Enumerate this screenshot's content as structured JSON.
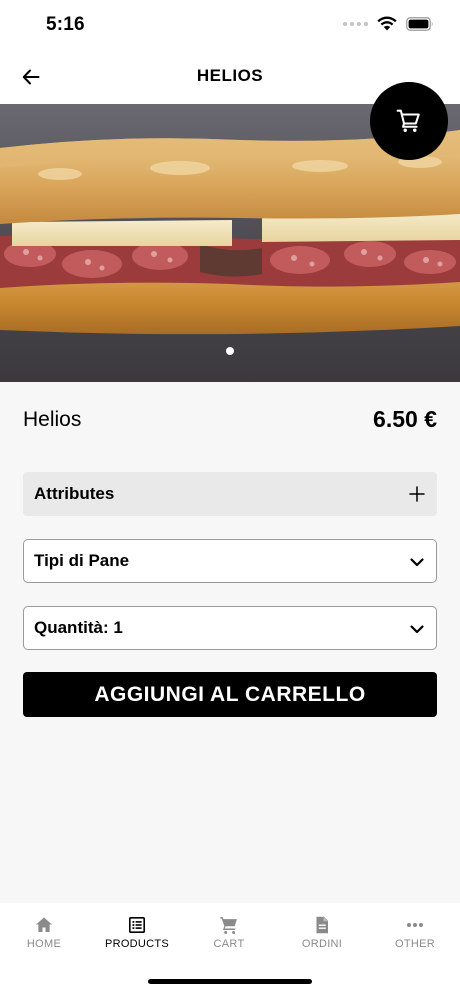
{
  "status_bar": {
    "time": "5:16"
  },
  "header": {
    "title": "HELIOS",
    "back_icon": "arrow-left-icon"
  },
  "cart_fab": {
    "icon": "cart-icon"
  },
  "carousel": {
    "image_subject": "salami and cheese baguette sandwich",
    "page_count": 1,
    "active_index": 0
  },
  "product": {
    "name": "Helios",
    "price": "6.50 €"
  },
  "attributes": {
    "label": "Attributes",
    "icon": "plus-icon"
  },
  "bread_select": {
    "label": "Tipi di Pane",
    "icon": "chevron-down-icon"
  },
  "quantity_select": {
    "label": "Quantità: 1",
    "icon": "chevron-down-icon"
  },
  "add_to_cart": {
    "label": "AGGIUNGI AL CARRELLO"
  },
  "bottom_nav": {
    "items": [
      {
        "label": "HOME",
        "icon": "home-icon",
        "active": false
      },
      {
        "label": "PRODUCTS",
        "icon": "list-icon",
        "active": true
      },
      {
        "label": "CART",
        "icon": "cart-icon",
        "active": false
      },
      {
        "label": "ORDINI",
        "icon": "document-icon",
        "active": false
      },
      {
        "label": "OTHER",
        "icon": "more-dots-icon",
        "active": false
      }
    ]
  },
  "colors": {
    "accent": "#000000",
    "background": "#f7f7f7",
    "inactive_nav": "#8a8a8a",
    "attributes_bg": "#e9e9e9"
  }
}
